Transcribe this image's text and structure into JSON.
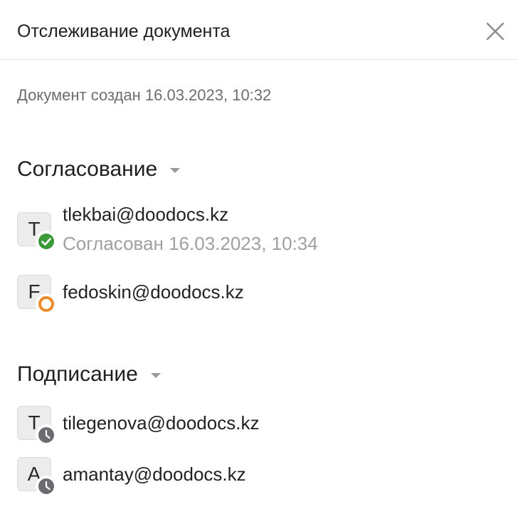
{
  "header": {
    "title": "Отслеживание документа",
    "close_icon": "close-icon"
  },
  "created_text": "Документ создан 16.03.2023, 10:32",
  "sections": [
    {
      "title": "Согласование",
      "people": [
        {
          "initial": "T",
          "email": "tlekbai@doodocs.kz",
          "status": "approved",
          "status_icon": "check-circle-icon",
          "status_color": "#3a9a3a",
          "status_text": "Согласован 16.03.2023, 10:34"
        },
        {
          "initial": "F",
          "email": "fedoskin@doodocs.kz",
          "status": "in-progress",
          "status_icon": "ring-icon",
          "status_color": "#ee8a2a"
        }
      ]
    },
    {
      "title": "Подписание",
      "people": [
        {
          "initial": "T",
          "email": "tilegenova@doodocs.kz",
          "status": "pending",
          "status_icon": "clock-icon",
          "status_color": "#6b6b70"
        },
        {
          "initial": "A",
          "email": "amantay@doodocs.kz",
          "status": "pending",
          "status_icon": "clock-icon",
          "status_color": "#6b6b70"
        }
      ]
    }
  ]
}
